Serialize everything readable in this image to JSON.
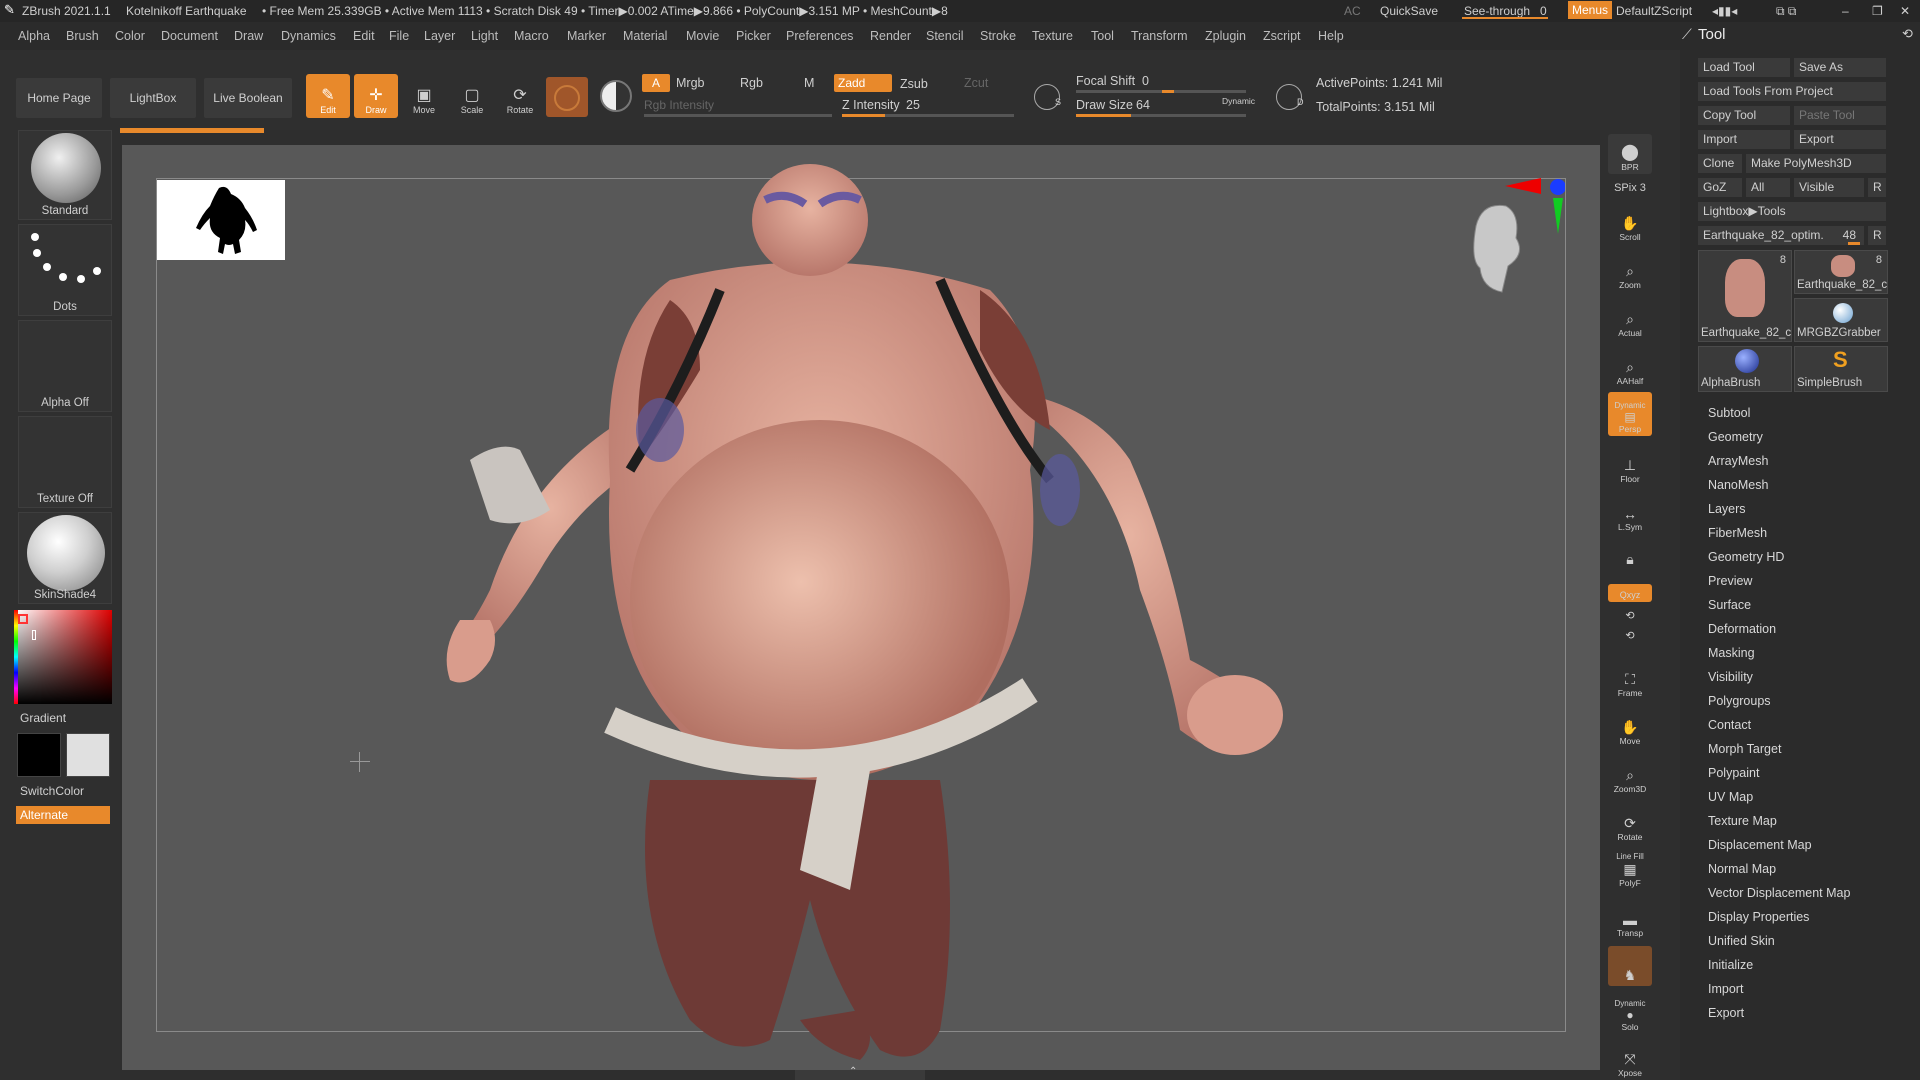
{
  "titlebar": {
    "app": "ZBrush 2021.1.1",
    "doc": "Kotelnikoff Earthquake",
    "stats": "• Free Mem 25.339GB • Active Mem 1113 • Scratch Disk 49 • Timer▶0.002 ATime▶9.866 • PolyCount▶3.151 MP • MeshCount▶8",
    "ac": "AC",
    "quicksave": "QuickSave",
    "seethrough": "See-through",
    "seethrough_value": "0",
    "menus": "Menus",
    "script": "DefaultZScript"
  },
  "menu": [
    "Alpha",
    "Brush",
    "Color",
    "Document",
    "Draw",
    "Dynamics",
    "Edit",
    "File",
    "Layer",
    "Light",
    "Macro",
    "Marker",
    "Material",
    "Movie",
    "Picker",
    "Preferences",
    "Render",
    "Stencil",
    "Stroke",
    "Texture",
    "Tool",
    "Transform",
    "Zplugin",
    "Zscript",
    "Help"
  ],
  "toolbar": {
    "home": "Home Page",
    "lightbox": "LightBox",
    "liveboolean": "Live Boolean",
    "edit": "Edit",
    "draw": "Draw",
    "move": "Move",
    "scale": "Scale",
    "rotate": "Rotate",
    "a": "A",
    "mrgb": "Mrgb",
    "rgb": "Rgb",
    "m": "M",
    "zadd": "Zadd",
    "zsub": "Zsub",
    "zcut": "Zcut",
    "rgb_intensity": "Rgb Intensity",
    "z_intensity_label": "Z Intensity",
    "z_intensity": "25",
    "z_intensity_fraction": 0.25,
    "focal_label": "Focal Shift",
    "focal": "0",
    "drawsize_label": "Draw Size",
    "drawsize": "64",
    "dynamic": "Dynamic",
    "active_points": "ActivePoints: 1.241 Mil",
    "total_points": "TotalPoints: 3.151 Mil"
  },
  "leftshelf": {
    "brush": "Standard",
    "stroke": "Dots",
    "alpha": "Alpha Off",
    "texture": "Texture Off",
    "material": "SkinShade4",
    "gradient": "Gradient",
    "switchcolor": "SwitchColor",
    "alternate": "Alternate"
  },
  "rightshelf": [
    "BPR",
    "SPix 3",
    "Scroll",
    "Zoom",
    "Actual",
    "AAHalf",
    "Persp",
    "Floor",
    "L.Sym",
    "Frame",
    "Move",
    "Zoom3D",
    "Rotate",
    "PolyF",
    "Transp",
    "Solo",
    "Xpose"
  ],
  "rightshelf_extra": {
    "dynamic": "Dynamic",
    "linefill": "Line Fill",
    "xyz": "Qxyz"
  },
  "toolpanel": {
    "title": "Tool",
    "load_tool": "Load Tool",
    "save_as": "Save As",
    "load_from_project": "Load Tools From Project",
    "copy_tool": "Copy Tool",
    "paste_tool": "Paste Tool",
    "import": "Import",
    "export": "Export",
    "clone": "Clone",
    "make_polymesh": "Make PolyMesh3D",
    "goz": "GoZ",
    "all": "All",
    "visible": "Visible",
    "r": "R",
    "lightbox_tools": "Lightbox▶Tools",
    "current_tool": "Earthquake_82_optim.",
    "current_tool_value": "48",
    "thumbs": [
      {
        "label": "Earthquake_82_c",
        "count": "8"
      },
      {
        "label": "Earthquake_82_c",
        "count": "8"
      },
      {
        "label": "MRGBZGrabber",
        "count": ""
      },
      {
        "label": "AlphaBrush",
        "count": ""
      },
      {
        "label": "SimpleBrush",
        "count": ""
      }
    ],
    "subpalettes": [
      "Subtool",
      "Geometry",
      "ArrayMesh",
      "NanoMesh",
      "Layers",
      "FiberMesh",
      "Geometry HD",
      "Preview",
      "Surface",
      "Deformation",
      "Masking",
      "Visibility",
      "Polygroups",
      "Contact",
      "Morph Target",
      "Polypaint",
      "UV Map",
      "Texture Map",
      "Displacement Map",
      "Normal Map",
      "Vector Displacement Map",
      "Display Properties",
      "Unified Skin",
      "Initialize",
      "Import",
      "Export"
    ]
  },
  "colors": {
    "accent": "#e8892b",
    "viewport_bg": "#585858",
    "skin": "#d89a8a",
    "pants": "#6e3a36"
  }
}
